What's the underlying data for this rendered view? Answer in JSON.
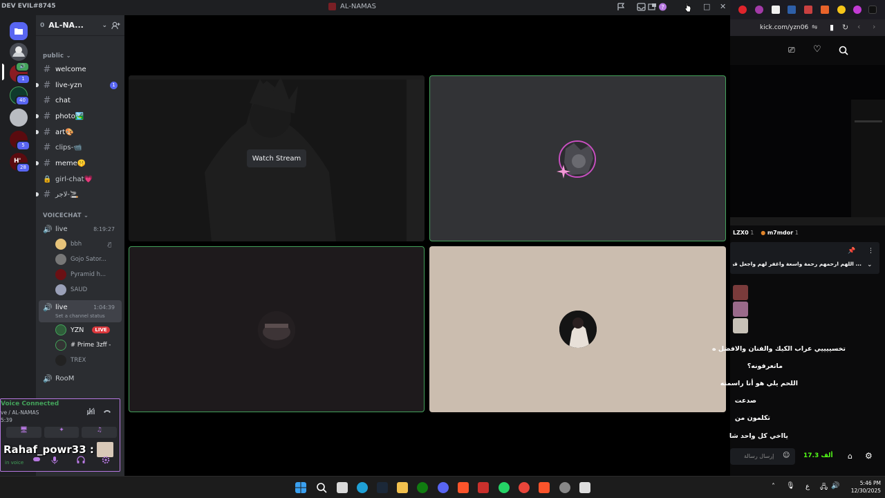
{
  "titlebar": {
    "user": "DEV EVIL#8745",
    "window_title": "AL-NAMAS"
  },
  "rail": {
    "badges": [
      "1",
      "40",
      "5",
      "28"
    ]
  },
  "server": {
    "name": "AL-NA...",
    "count": "0"
  },
  "categories": {
    "public": "public",
    "voicechat": "VOICECHAT"
  },
  "text_channels": [
    {
      "name": "welcome"
    },
    {
      "name": "live-yzn",
      "badge": "1"
    },
    {
      "name": "chat"
    },
    {
      "name": "photo🏞️"
    },
    {
      "name": "art🎨"
    },
    {
      "name": "clips-📹"
    },
    {
      "name": "meme🤫"
    },
    {
      "name": "girl-chat💗"
    },
    {
      "name": "لاجر-🚬"
    }
  ],
  "voice": {
    "live1": {
      "name": "live",
      "time": "8:19:27"
    },
    "live1_users": [
      "bbh",
      "Gojo Sator...",
      "Pyramid h...",
      "SAUD"
    ],
    "live2": {
      "name": "live",
      "time": "1:04:39",
      "status": "Set a channel status"
    },
    "live2_users": [
      {
        "name": "YZN",
        "tag": "LIVE"
      },
      {
        "name": "# Prime 3zff -"
      },
      {
        "name": "TREX"
      }
    ],
    "room": "RooM"
  },
  "user_panel": {
    "connected": "Voice Connected",
    "channel": "ve / AL-NAMAS",
    "time": "5:39",
    "overlay_name": "Rahaf_powr33 :",
    "status": "in voice"
  },
  "stage": {
    "watch_stream": "Watch Stream"
  },
  "browser": {
    "url": "kick.com/yzn06",
    "viewer1": "LZX0",
    "viewer1_count": "1",
    "viewer2": "m7mdor",
    "viewer2_count": "1",
    "pinned": "... اللهم ارحمهم رحمة واسعة واغفر لهم واجعل قبورهم رو",
    "messages": [
      "تخسييييي عراب الكيك والفنان والافضل ه",
      "ماتعرفونه؟",
      "اللحم يلي هو أنا راسمته",
      "صدعت",
      "تكلمون من",
      "يااخي كل واحد شا"
    ],
    "input_placeholder": "إرسال رسالة",
    "points": "17.3 ألف"
  },
  "taskbar": {
    "time": "5:46 PM",
    "date": "12/30/2025",
    "lang": "ع"
  },
  "colors": {
    "accent": "#5865f2",
    "speaking": "#43a25a",
    "live": "#da373c",
    "kick": "#53fc18"
  }
}
